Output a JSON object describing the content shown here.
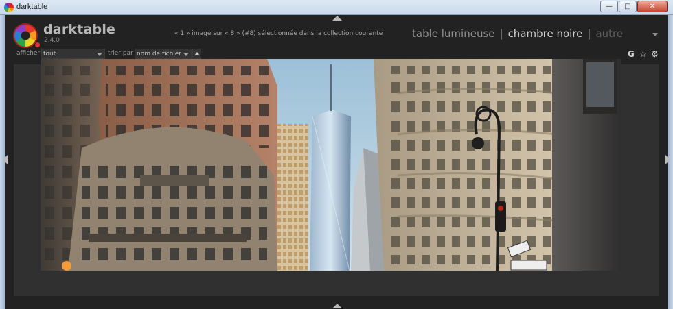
{
  "window": {
    "title": "darktable",
    "buttons": {
      "minimize": "—",
      "maximize": "□",
      "close": "✕"
    }
  },
  "app": {
    "name": "darktable",
    "version": "2.4.0",
    "collection_info": "« 1 » image sur « 8 » (#8) sélectionnée dans la collection courante",
    "views": {
      "lighttable": "table lumineuse",
      "darkroom": "chambre noire",
      "other": "autre",
      "separator": "|"
    }
  },
  "filterbar": {
    "show_label": "afficher",
    "show_value": "tout",
    "sort_label": "trier par",
    "sort_value": "nom de fichier"
  },
  "right_tools": {
    "g": "G",
    "star": "☆",
    "gear": "⚙"
  },
  "icons": {
    "titlebar": "darktable-app-icon",
    "logo": "darktable-logo-icon",
    "sort": "sort-ascending-icon",
    "grouping": "grouping-g-icon",
    "star": "star-icon",
    "settings": "gear-icon"
  }
}
